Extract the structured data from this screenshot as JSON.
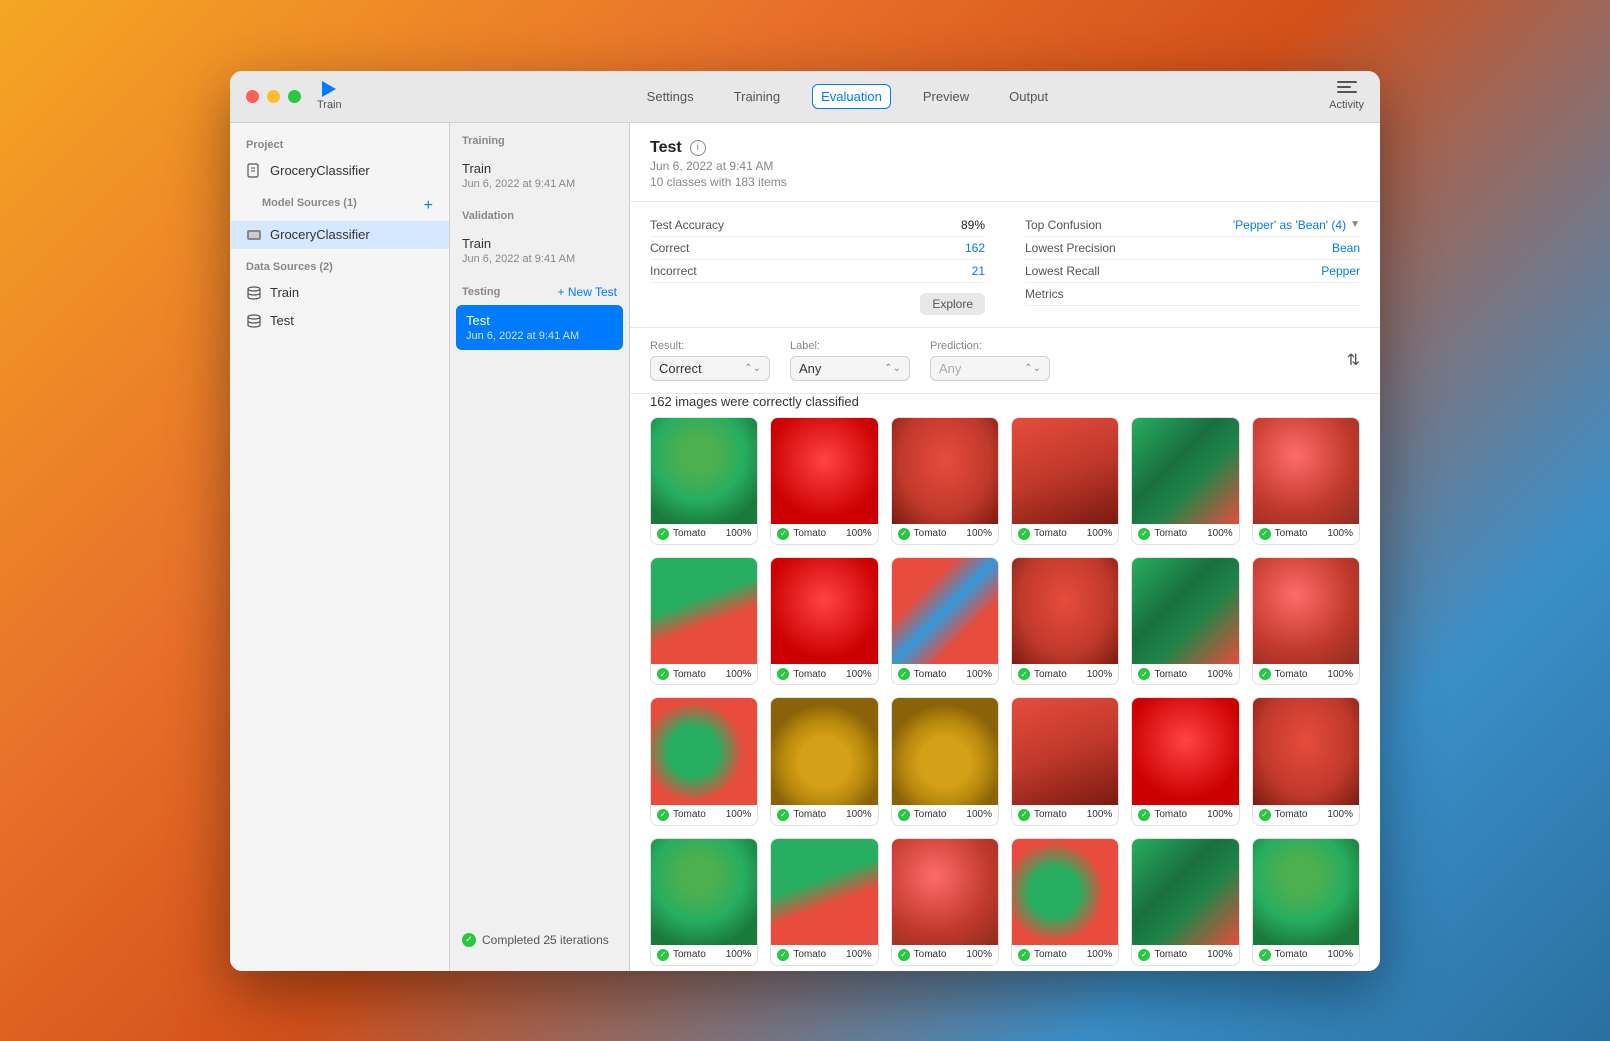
{
  "window": {
    "title": "GroceryClassifier"
  },
  "titlebar": {
    "train_label": "Train",
    "activity_label": "Activity"
  },
  "nav": {
    "tabs": [
      {
        "id": "settings",
        "label": "Settings"
      },
      {
        "id": "training",
        "label": "Training"
      },
      {
        "id": "evaluation",
        "label": "Evaluation",
        "active": true
      },
      {
        "id": "preview",
        "label": "Preview"
      },
      {
        "id": "output",
        "label": "Output"
      }
    ]
  },
  "sidebar": {
    "project_label": "Project",
    "project_name": "GroceryClassifier",
    "model_sources_label": "Model Sources (1)",
    "model_name": "GroceryClassifier",
    "data_sources_label": "Data Sources (2)",
    "data_sources": [
      {
        "id": "train",
        "label": "Train"
      },
      {
        "id": "test",
        "label": "Test"
      }
    ]
  },
  "left_panel": {
    "training_label": "Training",
    "training_item": {
      "title": "Train",
      "sub": "Jun 6, 2022 at 9:41 AM"
    },
    "validation_label": "Validation",
    "validation_item": {
      "title": "Train",
      "sub": "Jun 6, 2022 at 9:41 AM"
    },
    "testing_label": "Testing",
    "new_test_label": "+ New Test",
    "test_item": {
      "title": "Test",
      "sub": "Jun 6, 2022 at 9:41 AM"
    },
    "completed_label": "Completed 25 iterations"
  },
  "detail": {
    "title": "Test",
    "subtitle_date": "Jun 6, 2022 at 9:41 AM",
    "subtitle_classes": "10 classes with 183 items",
    "stats_left": [
      {
        "label": "Test Accuracy",
        "value": "89%",
        "type": "black"
      },
      {
        "label": "Correct",
        "value": "162",
        "type": "blue"
      },
      {
        "label": "Incorrect",
        "value": "21",
        "type": "blue"
      }
    ],
    "explore_label": "Explore",
    "stats_right": [
      {
        "label": "Top Confusion",
        "value": "'Pepper' as 'Bean' (4)",
        "type": "blue",
        "has_dropdown": true
      },
      {
        "label": "Lowest Precision",
        "value": "Bean",
        "type": "blue"
      },
      {
        "label": "Lowest Recall",
        "value": "Pepper",
        "type": "blue"
      },
      {
        "label": "Metrics",
        "value": "",
        "type": "plain"
      }
    ],
    "filters": {
      "result_label": "Result:",
      "result_value": "Correct",
      "label_label": "Label:",
      "label_value": "Any",
      "prediction_label": "Prediction:",
      "prediction_value": "Any"
    },
    "count_text": "162 images were correctly classified",
    "images": [
      {
        "label": "Tomato",
        "pct": "100%",
        "style": "img-tomato3"
      },
      {
        "label": "Tomato",
        "pct": "100%",
        "style": "img-tomato2"
      },
      {
        "label": "Tomato",
        "pct": "100%",
        "style": "img-tomato5"
      },
      {
        "label": "Tomato",
        "pct": "100%",
        "style": "img-tomato4"
      },
      {
        "label": "Tomato",
        "pct": "100%",
        "style": "img-tomato6"
      },
      {
        "label": "Tomato",
        "pct": "100%",
        "style": "img-tomato1"
      },
      {
        "label": "Tomato",
        "pct": "100%",
        "style": "img-plant"
      },
      {
        "label": "Tomato",
        "pct": "100%",
        "style": "img-tomato2"
      },
      {
        "label": "Tomato",
        "pct": "100%",
        "style": "img-tray"
      },
      {
        "label": "Tomato",
        "pct": "100%",
        "style": "img-tomato5"
      },
      {
        "label": "Tomato",
        "pct": "100%",
        "style": "img-tomato6"
      },
      {
        "label": "Tomato",
        "pct": "100%",
        "style": "img-tomato1"
      },
      {
        "label": "Tomato",
        "pct": "100%",
        "style": "img-cherry"
      },
      {
        "label": "Tomato",
        "pct": "100%",
        "style": "img-tomato-bowl"
      },
      {
        "label": "Tomato",
        "pct": "100%",
        "style": "img-tomato-bowl"
      },
      {
        "label": "Tomato",
        "pct": "100%",
        "style": "img-tomato4"
      },
      {
        "label": "Tomato",
        "pct": "100%",
        "style": "img-tomato2"
      },
      {
        "label": "Tomato",
        "pct": "100%",
        "style": "img-tomato5"
      },
      {
        "label": "Tomato",
        "pct": "100%",
        "style": "img-tomato3"
      },
      {
        "label": "Tomato",
        "pct": "100%",
        "style": "img-plant"
      },
      {
        "label": "Tomato",
        "pct": "100%",
        "style": "img-tomato1"
      },
      {
        "label": "Tomato",
        "pct": "100%",
        "style": "img-cherry"
      },
      {
        "label": "Tomato",
        "pct": "100%",
        "style": "img-tomato6"
      },
      {
        "label": "Tomato",
        "pct": "100%",
        "style": "img-tomato3"
      }
    ]
  }
}
